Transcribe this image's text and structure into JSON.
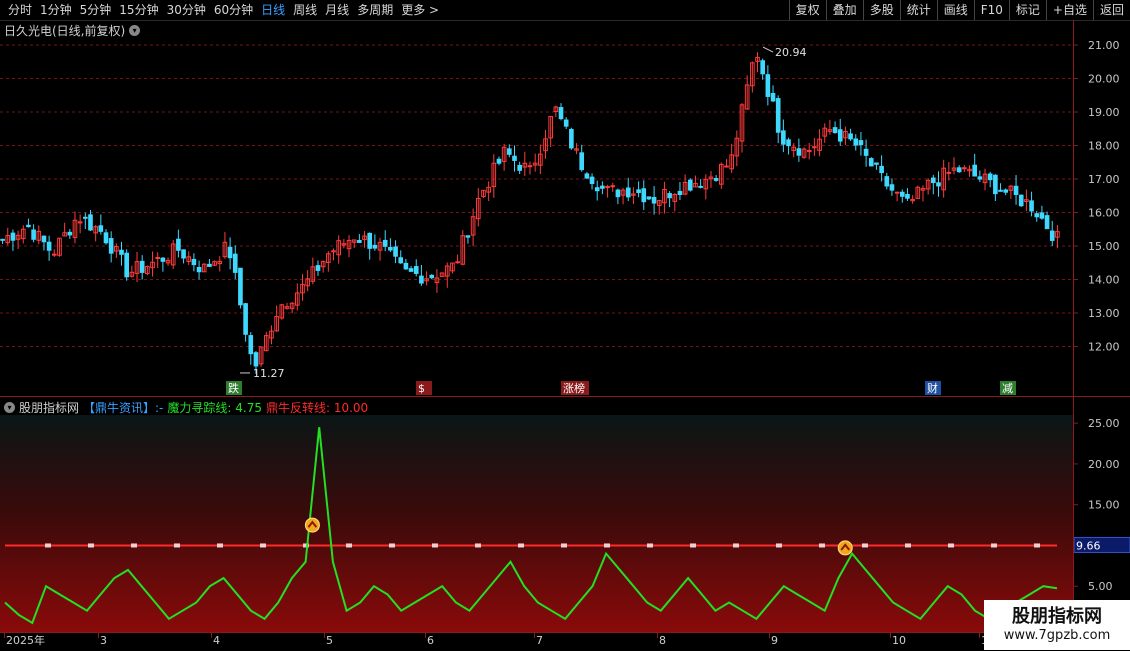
{
  "toolbar": {
    "periods": [
      "分时",
      "1分钟",
      "5分钟",
      "15分钟",
      "30分钟",
      "60分钟",
      "日线",
      "周线",
      "月线",
      "多周期",
      "更多 >"
    ],
    "active_period": "日线",
    "tools": [
      "复权",
      "叠加",
      "多股",
      "统计",
      "画线",
      "F10",
      "标记",
      "+自选",
      "返回"
    ]
  },
  "stock": {
    "title": "日久光电(日线,前复权)"
  },
  "price_axis": {
    "ticks": [
      "21.00",
      "20.00",
      "19.00",
      "18.00",
      "17.00",
      "16.00",
      "15.00",
      "14.00",
      "13.00",
      "12.00"
    ]
  },
  "price_annotations": {
    "high": "20.94",
    "low": "11.27"
  },
  "event_tags": [
    {
      "label": "跌",
      "color": "#2f7d2f"
    },
    {
      "label": "$",
      "color": "#8b1a1a"
    },
    {
      "label": "涨榜",
      "color": "#8b1a1a"
    },
    {
      "label": "财",
      "color": "#1f4fa0"
    },
    {
      "label": "减",
      "color": "#2f7d2f"
    }
  ],
  "indicator": {
    "name": "股朋指标网",
    "tag": "【鼎牛资讯】:-",
    "line1_label": "魔力寻踪线: 4.75",
    "line2_label": "鼎牛反转线: 10.00",
    "line1_color": "#22e022",
    "line2_color": "#ff2a2a",
    "axis_ticks": [
      "25.00",
      "20.00",
      "15.00",
      "10.00",
      "5.00"
    ],
    "current_marker": "9.66"
  },
  "dates": {
    "labels": [
      "2025年",
      "3",
      "4",
      "5",
      "6",
      "7",
      "8",
      "9",
      "10",
      "1"
    ]
  },
  "watermark": {
    "title": "股朋指标网",
    "url": "www.7gpzb.com"
  },
  "colors": {
    "up": "#ff3b3b",
    "down": "#3fd9ff",
    "grid": "#7a1414",
    "axis_text": "#c8c8c8"
  },
  "chart_data": {
    "type": "candlestick",
    "ylim": [
      11.0,
      21.3
    ],
    "annotations": [
      {
        "label": "20.94",
        "value": 20.94
      },
      {
        "label": "11.27",
        "value": 11.27
      }
    ],
    "approx_close_path": [
      15.2,
      15.6,
      14.8,
      15.9,
      15.4,
      14.2,
      14.5,
      14.9,
      14.3,
      15.0,
      11.3,
      13.2,
      13.8,
      14.8,
      15.3,
      15.0,
      14.2,
      14.1,
      14.4,
      16.5,
      17.8,
      17.2,
      19.1,
      17.5,
      16.6,
      16.7,
      16.4,
      16.8,
      17.0,
      17.5,
      20.9,
      18.3,
      17.8,
      18.5,
      18.0,
      17.0,
      16.2,
      16.9,
      17.3,
      17.0,
      16.6,
      16.2,
      15.2
    ],
    "indicator_ylim": [
      0,
      26
    ],
    "indicator_threshold": 10.0,
    "indicator_last": 4.75,
    "indicator_path": [
      3,
      1.5,
      0.5,
      5,
      4,
      3,
      2,
      4,
      6,
      7,
      5,
      3,
      1,
      2,
      3,
      5,
      6,
      4,
      2,
      1,
      3,
      6,
      8,
      24.5,
      8,
      2,
      3,
      5,
      4,
      2,
      3,
      4,
      5,
      3,
      2,
      4,
      6,
      8,
      5,
      3,
      2,
      1,
      3,
      5,
      9,
      7,
      5,
      3,
      2,
      4,
      6,
      4,
      2,
      3,
      2,
      1,
      3,
      5,
      4,
      3,
      2,
      6,
      9,
      7,
      5,
      3,
      2,
      1,
      3,
      5,
      4,
      2,
      1,
      2,
      3,
      4,
      5,
      4.75
    ]
  }
}
